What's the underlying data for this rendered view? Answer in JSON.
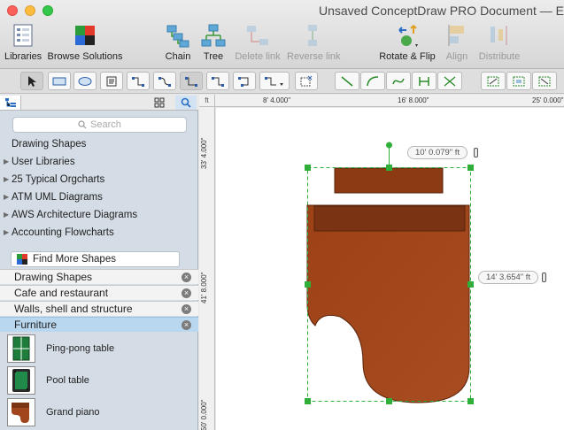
{
  "window": {
    "title": "Unsaved ConceptDraw PRO Document — Edi"
  },
  "toolbar": {
    "libraries": "Libraries",
    "browse_solutions": "Browse Solutions",
    "chain": "Chain",
    "tree": "Tree",
    "delete_link": "Delete link",
    "reverse_link": "Reverse link",
    "rotate_flip": "Rotate & Flip",
    "align": "Align",
    "distribute": "Distribute"
  },
  "search": {
    "placeholder": "Search"
  },
  "libraries": [
    {
      "label": "Drawing Shapes",
      "expandable": false
    },
    {
      "label": "User Libraries",
      "expandable": true
    },
    {
      "label": "25 Typical Orgcharts",
      "expandable": true
    },
    {
      "label": "ATM UML Diagrams",
      "expandable": true
    },
    {
      "label": "AWS Architecture Diagrams",
      "expandable": true
    },
    {
      "label": "Accounting Flowcharts",
      "expandable": true
    }
  ],
  "find_more": "Find More Shapes",
  "stencils": [
    {
      "label": "Drawing Shapes",
      "selected": false
    },
    {
      "label": "Cafe and restaurant",
      "selected": false
    },
    {
      "label": "Walls, shell and structure",
      "selected": false
    },
    {
      "label": "Furniture",
      "selected": true
    }
  ],
  "shapes": [
    {
      "label": "Ping-pong table",
      "icon": "ping-pong-table-icon"
    },
    {
      "label": "Pool table",
      "icon": "pool-table-icon"
    },
    {
      "label": "Grand piano",
      "icon": "grand-piano-icon"
    }
  ],
  "rulers": {
    "unit": "ft",
    "top": [
      "8' 4.000\"",
      "16' 8.000\"",
      "25' 0.000\""
    ],
    "left": [
      "33' 4.000\"",
      "41' 8.000\"",
      "50' 0.000\""
    ]
  },
  "selection": {
    "width_label": "10' 0.079\" ft",
    "height_label": "14' 3.654\" ft"
  },
  "colors": {
    "piano_dark": "#7a3414",
    "piano_body": "#a0451c",
    "selection": "#2fae3a",
    "stencil_selected": "#b9d7ef"
  }
}
